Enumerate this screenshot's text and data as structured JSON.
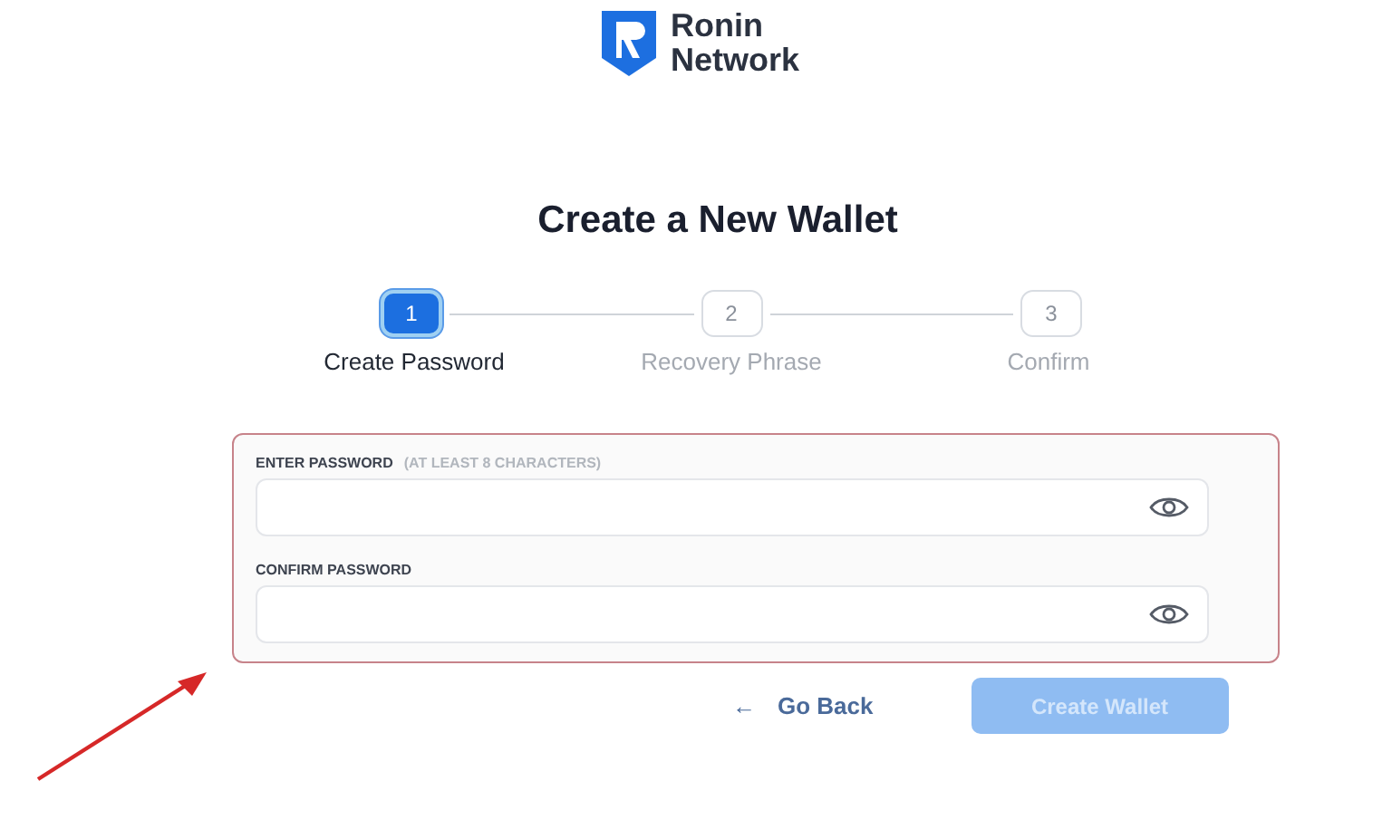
{
  "logo": {
    "line1": "Ronin",
    "line2": "Network"
  },
  "title": "Create a New Wallet",
  "steps": [
    {
      "number": "1",
      "label": "Create Password",
      "selected": true
    },
    {
      "number": "2",
      "label": "Recovery Phrase",
      "selected": false
    },
    {
      "number": "3",
      "label": "Confirm",
      "selected": false
    }
  ],
  "fields": [
    {
      "label": "ENTER PASSWORD",
      "hint": "(AT LEAST 8 CHARACTERS)"
    },
    {
      "label": "CONFIRM PASSWORD"
    }
  ],
  "buttons": [
    {
      "kind": "link",
      "icon": "←",
      "label": "Go Back"
    },
    {
      "kind": "primary",
      "label": "Create Wallet",
      "disabled": true
    }
  ]
}
